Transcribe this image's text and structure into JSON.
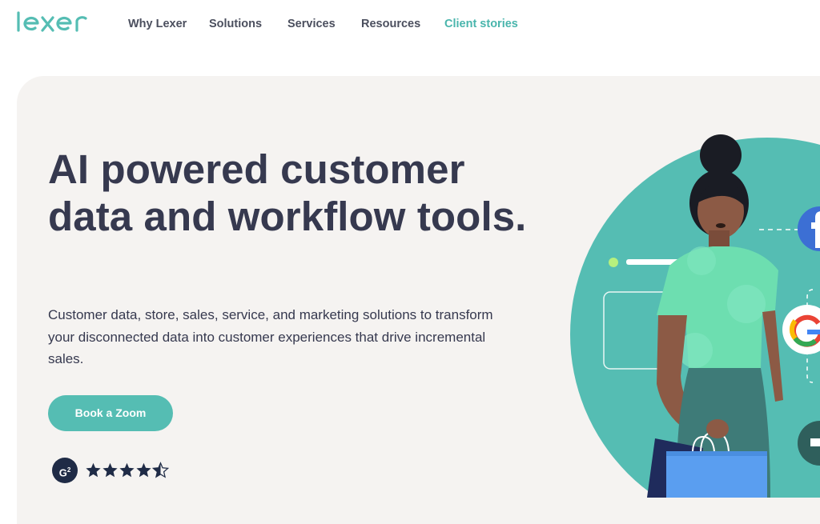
{
  "brand": {
    "logo_text": "lexer",
    "accent_color": "#55bdb3"
  },
  "nav": {
    "items": [
      {
        "label": "Why Lexer"
      },
      {
        "label": "Solutions"
      },
      {
        "label": "Services"
      },
      {
        "label": "Resources"
      },
      {
        "label": "Client stories"
      }
    ]
  },
  "hero": {
    "headline": "AI powered customer data and workflow tools.",
    "subtext": "Customer data, store, sales, service, and marketing solutions to transform your disconnected data into customer experiences that drive incremental sales.",
    "cta_label": "Book a Zoom",
    "rating": {
      "badge_label": "G2",
      "stars": 4.5,
      "max_stars": 5
    }
  },
  "illustration": {
    "icons": [
      "facebook-icon",
      "google-icon",
      "play-icon"
    ]
  }
}
